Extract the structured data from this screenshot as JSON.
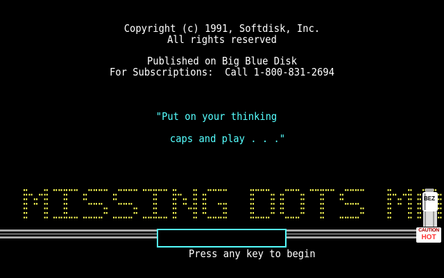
{
  "credits": {
    "copyright": "Copyright (c) 1991, Softdisk, Inc.",
    "rights": "All rights reserved",
    "published": "Published on Big Blue Disk",
    "subscriptions": "For Subscriptions:  Call 1-800-831-2694"
  },
  "tagline": {
    "line1": "\"Put on your thinking",
    "line2": "caps and play . . .\""
  },
  "title": {
    "text": "MISSING DOTS MATRIX",
    "color": "#ffff55"
  },
  "prompt": {
    "text": "Press any key to begin"
  },
  "coffee_pot": {
    "label": "BEZ",
    "caution_top": "CAUTION",
    "caution_bottom": "HOT"
  },
  "colors": {
    "background": "#000000",
    "text": "#ffffff",
    "accent": "#55ffff",
    "title": "#ffff55",
    "rail_light": "#aaaaaa",
    "rail_dark": "#555555"
  }
}
